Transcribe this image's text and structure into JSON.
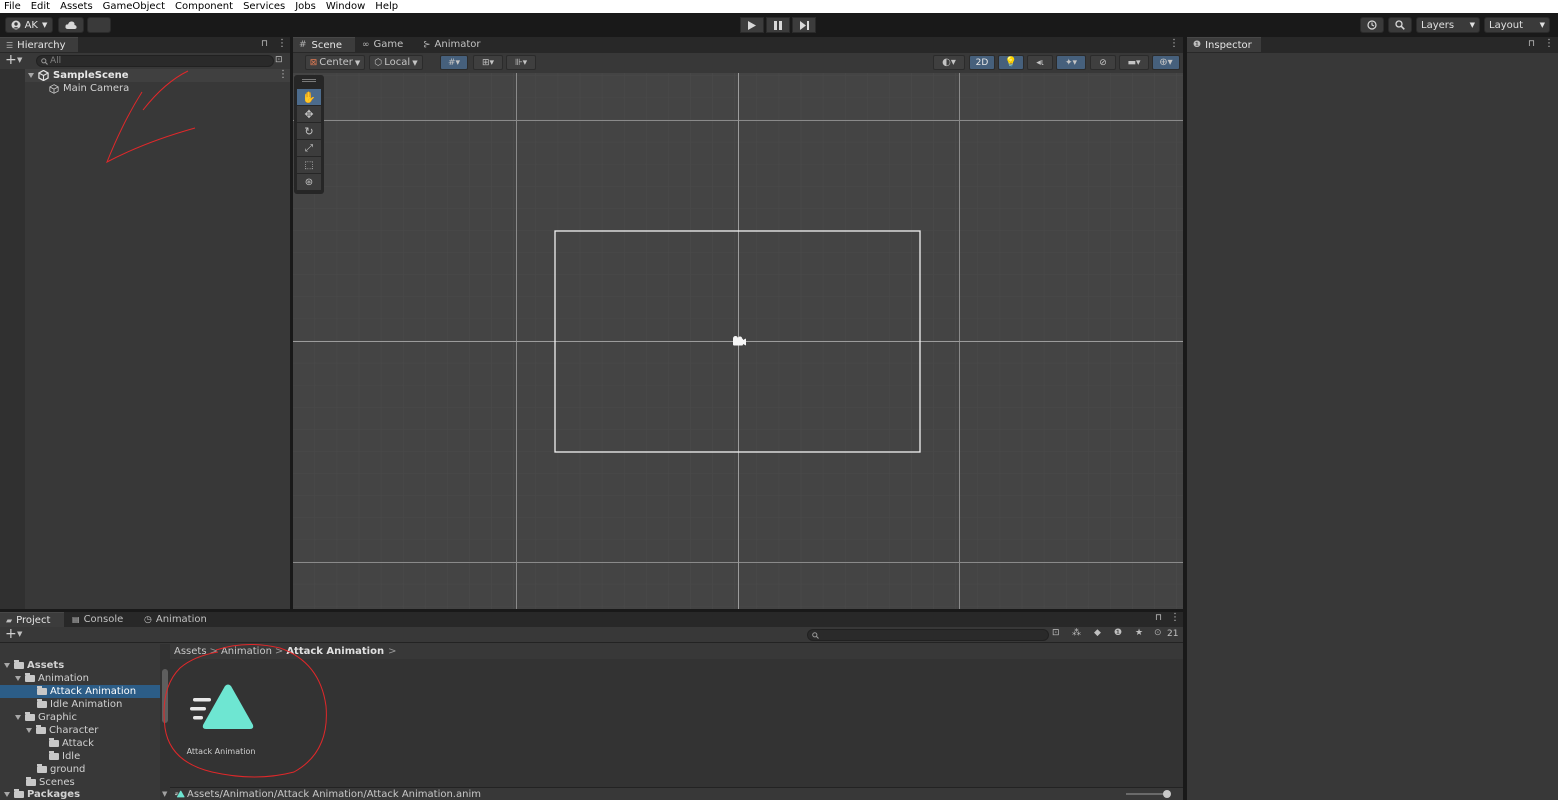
{
  "menu": [
    "File",
    "Edit",
    "Assets",
    "GameObject",
    "Component",
    "Services",
    "Jobs",
    "Window",
    "Help"
  ],
  "toolbar": {
    "account_label": "AK",
    "layers_label": "Layers",
    "layout_label": "Layout"
  },
  "hierarchy": {
    "tab_label": "Hierarchy",
    "search_placeholder": "All",
    "scene_name": "SampleScene",
    "items": [
      "Main Camera"
    ]
  },
  "scene_view": {
    "tabs": [
      "Scene",
      "Game",
      "Animator"
    ],
    "pivot_label": "Center",
    "space_label": "Local",
    "mode_label": "2D"
  },
  "inspector": {
    "tab_label": "Inspector"
  },
  "project": {
    "tabs": [
      "Project",
      "Console",
      "Animation"
    ],
    "hidden_count": "21",
    "breadcrumb": [
      "Assets",
      "Animation",
      "Attack Animation"
    ],
    "tree": {
      "assets": "Assets",
      "animation": "Animation",
      "attack_animation": "Attack Animation",
      "idle_animation": "Idle Animation",
      "graphic": "Graphic",
      "character": "Character",
      "attack": "Attack",
      "idle": "Idle",
      "ground": "ground",
      "scenes": "Scenes",
      "packages": "Packages"
    },
    "asset_name": "Attack Animation",
    "status_path": "Assets/Animation/Attack Animation/Attack Animation.anim"
  },
  "colors": {
    "annotation_red": "#e0282a",
    "anim_icon_teal": "#6ee6d2",
    "selection_blue": "#2c5d87"
  }
}
